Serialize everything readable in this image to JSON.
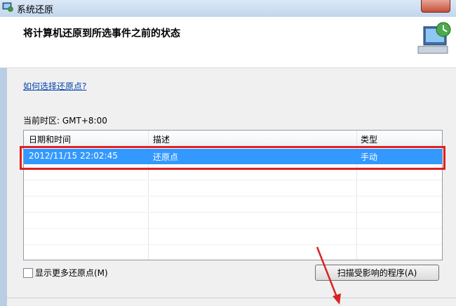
{
  "window": {
    "title": "系统还原"
  },
  "header": {
    "title": "将计算机还原到所选事件之前的状态"
  },
  "help": {
    "link": "如何选择还原点?"
  },
  "timezone": {
    "label": "当前时区: GMT+8:00"
  },
  "table": {
    "columns": [
      "日期和时间",
      "描述",
      "类型"
    ],
    "rows": [
      {
        "datetime": "2012/11/15 22:02:45",
        "description": "还原点",
        "type": "手动"
      }
    ]
  },
  "options": {
    "show_more_label": "显示更多还原点(M)"
  },
  "actions": {
    "scan_label": "扫描受影响的程序(A)"
  },
  "colors": {
    "selection": "#3399ff",
    "highlight_frame": "#e02020",
    "link": "#0645ad"
  }
}
